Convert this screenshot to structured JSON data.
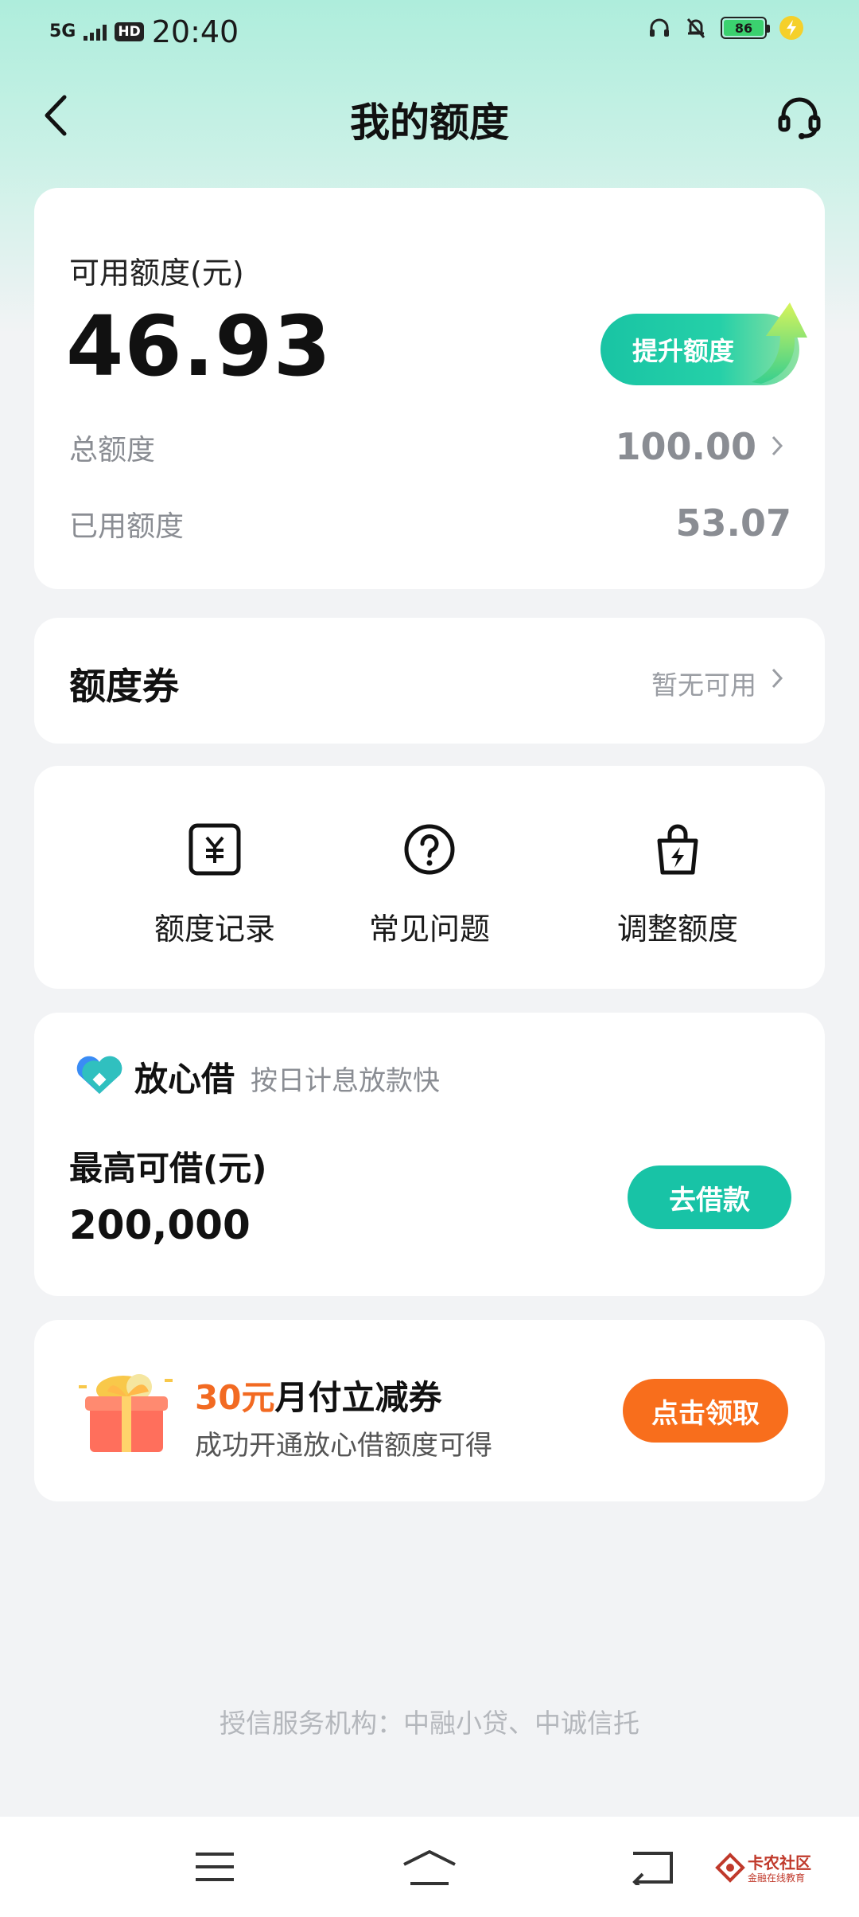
{
  "status_bar": {
    "network": "5G",
    "hd": "HD",
    "time": "20:40",
    "battery": "86"
  },
  "nav": {
    "title": "我的额度",
    "back_icon": "chevron-left-icon",
    "service_icon": "headset-icon"
  },
  "quota": {
    "available_label": "可用额度(元)",
    "available_amount": "46.93",
    "raise_button": "提升额度",
    "total_label": "总额度",
    "total_value": "100.00",
    "used_label": "已用额度",
    "used_value": "53.07"
  },
  "coupon": {
    "title": "额度券",
    "status": "暂无可用"
  },
  "tools": [
    {
      "label": "额度记录",
      "icon": "yuan-receipt-icon"
    },
    {
      "label": "常见问题",
      "icon": "question-circle-icon"
    },
    {
      "label": "调整额度",
      "icon": "lightning-bag-icon"
    }
  ],
  "loan": {
    "brand": "放心借",
    "slogan": "按日计息放款快",
    "max_label": "最高可借(元)",
    "max_value": "200,000",
    "button": "去借款"
  },
  "promo": {
    "amount": "30元",
    "title_rest": "月付立减券",
    "subtitle": "成功开通放心借额度可得",
    "button": "点击领取"
  },
  "footer_note": "授信服务机构：中融小贷、中诚信托",
  "watermark": {
    "title": "卡农社区",
    "subtitle": "金融在线教育"
  },
  "colors": {
    "accent": "#18c3a6",
    "promo_orange": "#f86e1c",
    "header_mint": "#aeeddc"
  }
}
